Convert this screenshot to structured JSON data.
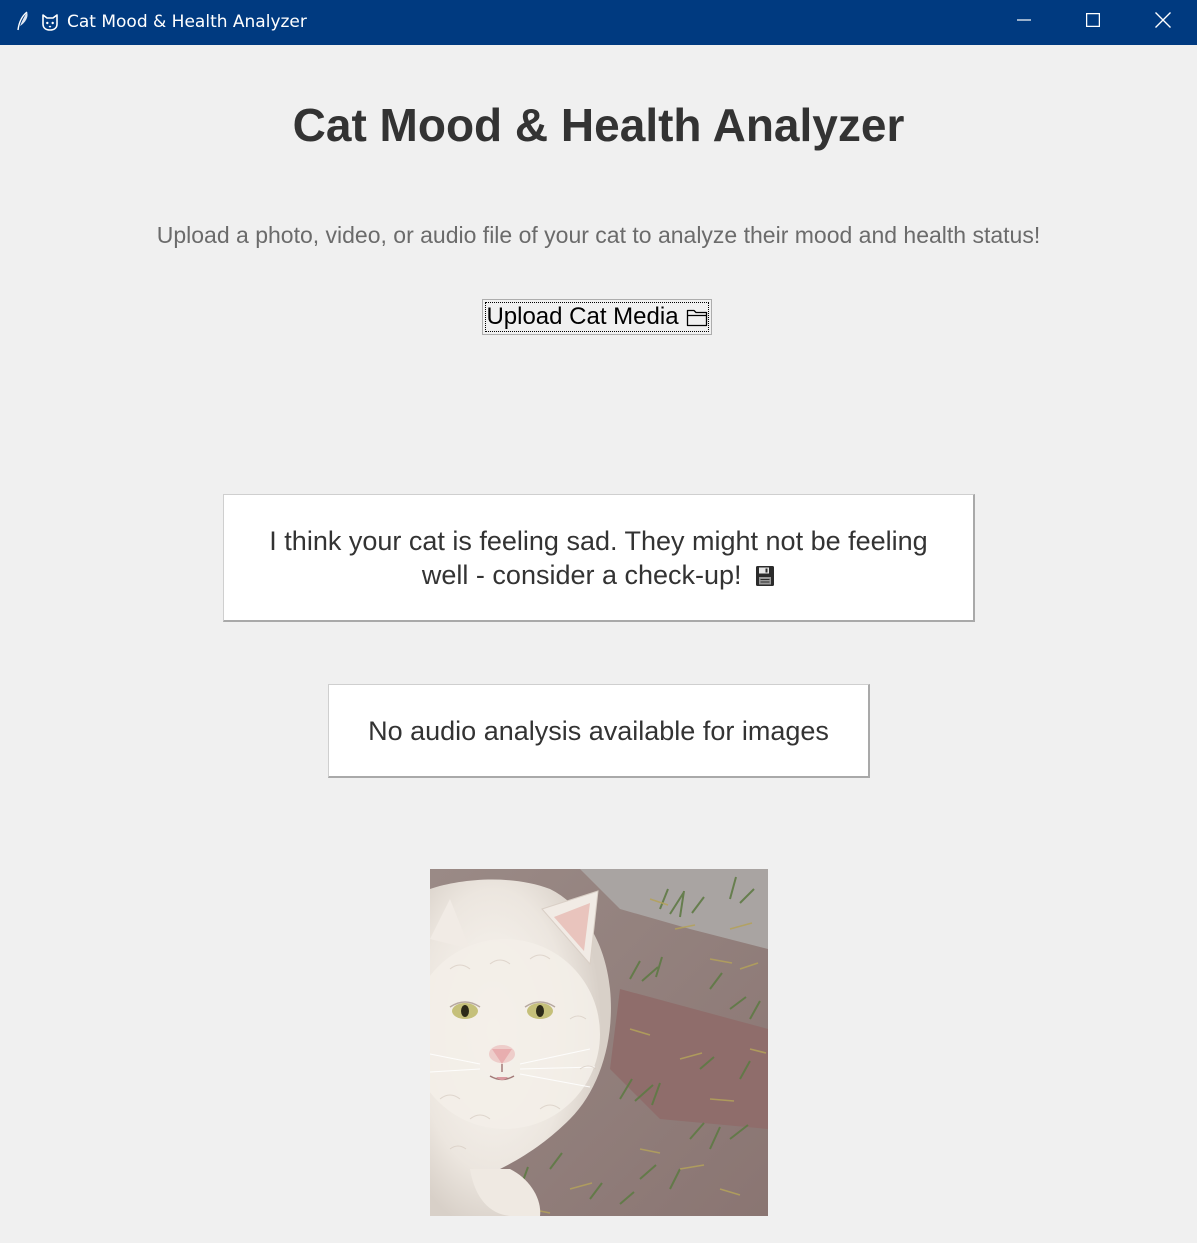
{
  "window": {
    "title": "Cat Mood & Health Analyzer",
    "titlebar_color": "#003a80",
    "controls": [
      "minimize-icon",
      "maximize-icon",
      "close-icon"
    ]
  },
  "header": {
    "title": "Cat Mood & Health Analyzer",
    "subtitle": "Upload a photo, video, or audio file of your cat to analyze their mood and health status!"
  },
  "upload": {
    "label": "Upload Cat Media",
    "icon": "folder-icon"
  },
  "result": {
    "mood_message": "I think your cat is feeling sad. They might not be feeling well - consider a check-up!",
    "mood_icon": "floppy-disk-icon",
    "audio_message": "No audio analysis available for images"
  },
  "preview": {
    "image": "cat-photo"
  }
}
